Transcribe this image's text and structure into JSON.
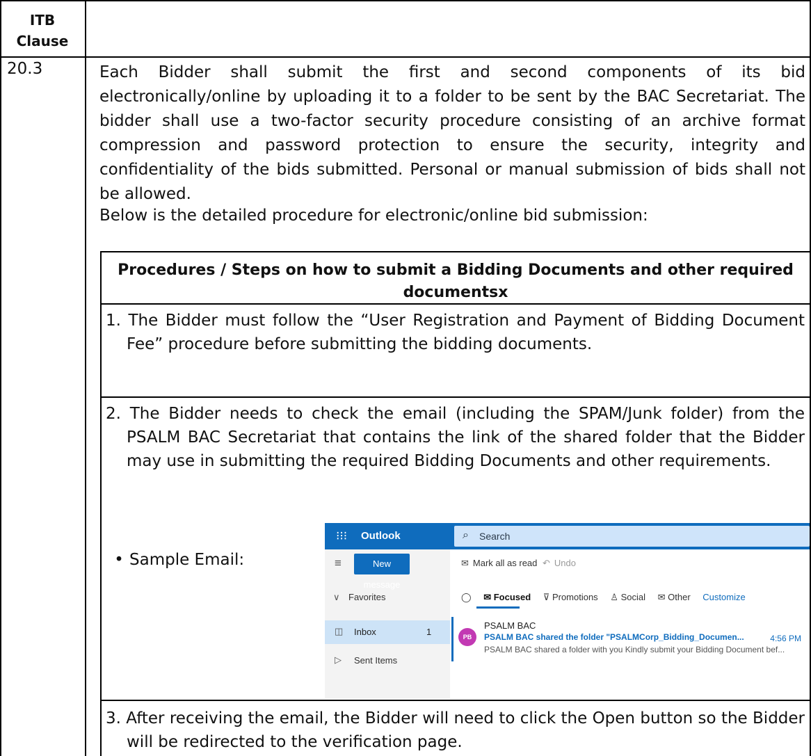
{
  "header": {
    "col1_line1": "ITB",
    "col1_line2": "Clause",
    "col2": ""
  },
  "clause": {
    "number": "20.3",
    "paragraph1": "Each Bidder shall submit the first and second components of its bid electronically/online by uploading it to a folder to be sent by the BAC Secretariat.  The bidder shall use a two-factor security procedure consisting of an archive format compression and password protection to ensure the security, integrity and confidentiality of the bids submitted. Personal or manual submission of bids shall not be allowed.",
    "paragraph2": "Below is the detailed procedure for electronic/online bid submission:"
  },
  "procedures": {
    "title": "Procedures / Steps on how to submit a Bidding Documents and other required documentsx",
    "steps": [
      "1. The Bidder must follow the “User Registration and Payment of Bidding Document Fee” procedure before submitting the bidding documents.",
      "2. The Bidder needs to check the email (including the SPAM/Junk folder) from the PSALM BAC Secretariat that contains the link of the shared folder that the Bidder may use in submitting the required Bidding Documents and other requirements.",
      "3. After receiving the email, the Bidder will need to click the Open button so the Bidder will be redirected to the verification page."
    ],
    "sample_label": "Sample Email:",
    "sample_bullet": "•"
  },
  "outlook": {
    "app_name": "Outlook",
    "search_placeholder": "Search",
    "new_message": "New message",
    "mark_all_read": "Mark all as read",
    "undo": "Undo",
    "favorites": "Favorites",
    "inbox": "Inbox",
    "inbox_count": "1",
    "sent_items": "Sent Items",
    "tabs": [
      "Focused",
      "Promotions",
      "Social",
      "Other"
    ],
    "customize": "Customize",
    "message": {
      "avatar": "PB",
      "from": "PSALM BAC",
      "subject": "PSALM BAC shared the folder \"PSALMCorp_Bidding_Documen...",
      "time": "4:56 PM",
      "preview": "PSALM BAC shared a folder with you Kindly submit your Bidding Document bef..."
    },
    "colors": {
      "brand": "#0f6cbd",
      "avatar": "#c239b3",
      "selected_folder": "#cde3f7"
    }
  }
}
